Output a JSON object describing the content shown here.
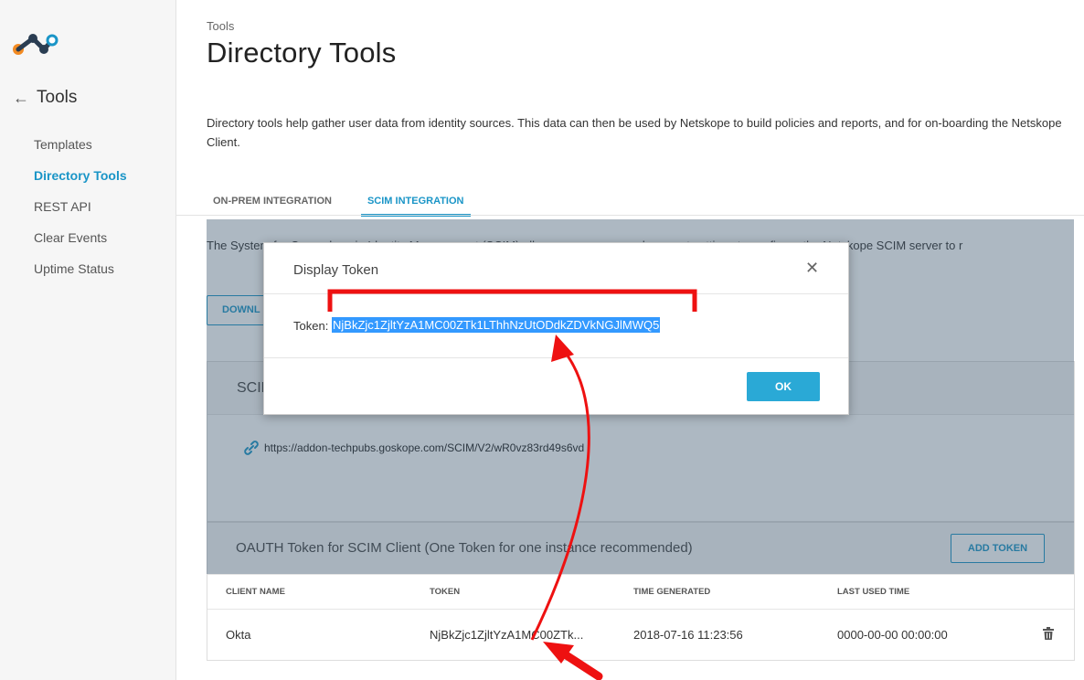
{
  "sidebar": {
    "back_label": "Tools",
    "items": [
      {
        "label": "Templates"
      },
      {
        "label": "Directory Tools"
      },
      {
        "label": "REST API"
      },
      {
        "label": "Clear Events"
      },
      {
        "label": "Uptime Status"
      }
    ]
  },
  "header": {
    "breadcrumb": "Tools",
    "title": "Directory Tools",
    "description": "Directory tools help gather user data from identity sources. This data can then be used by Netskope to build policies and reports, and for on-boarding the Netskope Client."
  },
  "tabs": [
    {
      "label": "ON-PREM INTEGRATION"
    },
    {
      "label": "SCIM INTEGRATION"
    }
  ],
  "scim": {
    "description": "The System for Cross-domain Identity Management (SCIM) allows user, group, and account settings to configure the Netskope SCIM server to r",
    "download_label": "DOWNL",
    "card1_title": "SCIM",
    "card1_url": "https://addon-techpubs.goskope.com/SCIM/V2/wR0vz83rd49s6vd"
  },
  "token_card": {
    "title": "OAUTH Token for SCIM Client (One Token for one instance recommended)",
    "add_button": "ADD TOKEN",
    "columns": [
      "CLIENT NAME",
      "TOKEN",
      "TIME GENERATED",
      "LAST USED TIME"
    ],
    "rows": [
      {
        "client_name": "Okta",
        "token": "NjBkZjc1ZjltYzA1MC00ZTk...",
        "time_generated": "2018-07-16 11:23:56",
        "last_used": "0000-00-00 00:00:00"
      }
    ]
  },
  "modal": {
    "title": "Display Token",
    "token_label": "Token:",
    "token_value": "NjBkZjc1ZjltYzA1MC00ZTk1LThhNzUtODdkZDVkNGJlMWQ5",
    "ok_label": "OK"
  },
  "colors": {
    "accent": "#1a95c7",
    "ok_button": "#2aa9d6",
    "selection": "#3399ff",
    "annotation": "#ee1111"
  }
}
